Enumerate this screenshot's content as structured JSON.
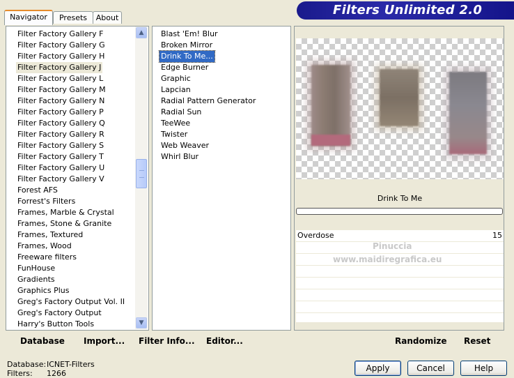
{
  "tabs": [
    {
      "label": "Navigator"
    },
    {
      "label": "Presets"
    },
    {
      "label": "About"
    }
  ],
  "banner": {
    "title": "Filters Unlimited 2.0"
  },
  "categories": [
    "Filter Factory Gallery F",
    "Filter Factory Gallery G",
    "Filter Factory Gallery H",
    "Filter Factory Gallery J",
    "Filter Factory Gallery L",
    "Filter Factory Gallery M",
    "Filter Factory Gallery N",
    "Filter Factory Gallery P",
    "Filter Factory Gallery Q",
    "Filter Factory Gallery R",
    "Filter Factory Gallery S",
    "Filter Factory Gallery T",
    "Filter Factory Gallery U",
    "Filter Factory Gallery V",
    "Forest AFS",
    "Forrest's Filters",
    "Frames, Marble & Crystal",
    "Frames, Stone & Granite",
    "Frames, Textured",
    "Frames, Wood",
    "Freeware filters",
    "FunHouse",
    "Gradients",
    "Graphics Plus",
    "Greg's Factory Output Vol. II",
    "Greg's Factory Output",
    "Harry's Button Tools"
  ],
  "filters": [
    "Blast 'Em! Blur",
    "Broken Mirror",
    "Drink To Me...",
    "Edge Burner",
    "Graphic",
    "Lapcian",
    "Radial Pattern Generator",
    "Radial Sun",
    "TeeWee",
    "Twister",
    "Web Weaver",
    "Whirl Blur"
  ],
  "filter_name": "Drink To Me",
  "param": {
    "label": "Overdose",
    "value": "15"
  },
  "watermark": {
    "line1": "Pinuccia",
    "line2": "www.maidiregrafica.eu"
  },
  "actions": {
    "database": "Database",
    "import": "Import...",
    "filter_info": "Filter Info...",
    "editor": "Editor...",
    "randomize": "Randomize",
    "reset": "Reset"
  },
  "status": {
    "database_label": "Database:",
    "database_value": "ICNET-Filters",
    "filters_label": "Filters:",
    "filters_value": "1266"
  },
  "buttons": {
    "apply": "Apply",
    "cancel": "Cancel",
    "help": "Help"
  },
  "icons": {
    "scroll_up": "scroll-up-arrow",
    "scroll_down": "scroll-down-arrow"
  },
  "colors": {
    "banner": "#1a1a8c",
    "selection": "#316ac5",
    "active_tab_accent": "#e68b2c"
  }
}
